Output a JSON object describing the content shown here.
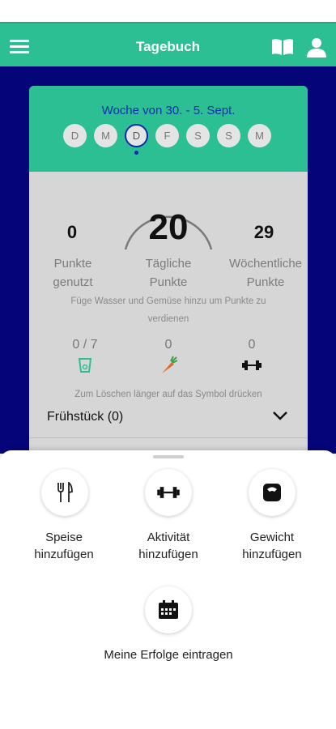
{
  "app_bar": {
    "title": "Tagebuch"
  },
  "week": {
    "label": "Woche von 30. - 5. Sept.",
    "days": [
      "D",
      "M",
      "D",
      "F",
      "S",
      "S",
      "M"
    ],
    "active_index": 2
  },
  "stats": {
    "used_value": "0",
    "used_label_1": "Punkte",
    "used_label_2": "genutzt",
    "daily_value": "20",
    "daily_label_1": "Tägliche",
    "daily_label_2": "Punkte",
    "weekly_value": "29",
    "weekly_label_1": "Wöchentliche",
    "weekly_label_2": "Punkte"
  },
  "hint_line_1": "Füge Wasser und Gemüse hinzu um Punkte zu",
  "hint_line_2": "verdienen",
  "trackers": {
    "water": "0 / 7",
    "vegetables": "0",
    "activity": "0"
  },
  "delete_hint": "Zum Löschen länger auf das Symbol drücken",
  "meal": {
    "label": "Frühstück (0)"
  },
  "sheet": {
    "food_1": "Speise",
    "food_2": "hinzufügen",
    "activity_1": "Aktivität",
    "activity_2": "hinzufügen",
    "weight_1": "Gewicht",
    "weight_2": "hinzufügen",
    "success": "Meine Erfolge eintragen"
  },
  "colors": {
    "primary": "#2bbf93",
    "navy": "#050579",
    "accent_blue": "#0a2cb0",
    "card_gray": "#d6d6d6"
  },
  "icons": {
    "menu": "hamburger-icon",
    "book": "book-icon",
    "profile": "user-icon",
    "water": "water-glass-icon",
    "vegetables": "carrot-icon",
    "activity": "dumbbell-icon",
    "chevron": "chevron-down-icon",
    "food": "fork-knife-icon",
    "weight": "scale-icon",
    "success": "calendar-icon"
  }
}
